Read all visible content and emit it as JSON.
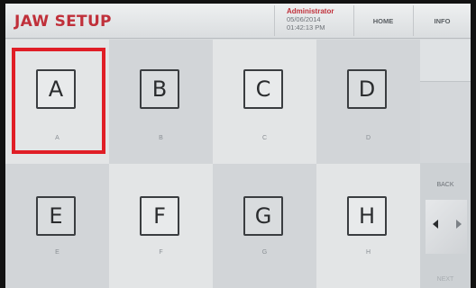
{
  "header": {
    "title": "JAW SETUP",
    "user": "Administrator",
    "date": "05/06/2014",
    "time": "01:42:13 PM",
    "home_label": "HOME",
    "info_label": "INFO"
  },
  "jaws": [
    {
      "letter": "A",
      "caption": "A",
      "selected": true
    },
    {
      "letter": "B",
      "caption": "B"
    },
    {
      "letter": "C",
      "caption": "C"
    },
    {
      "letter": "D",
      "caption": "D"
    },
    {
      "letter": "E",
      "caption": "E"
    },
    {
      "letter": "F",
      "caption": "F"
    },
    {
      "letter": "G",
      "caption": "G"
    },
    {
      "letter": "H",
      "caption": "H"
    }
  ],
  "nav": {
    "back_label": "BACK",
    "next_label": "NEXT",
    "prev_icon": "triangle-left",
    "next_icon": "triangle-right"
  },
  "colors": {
    "accent": "#c0303a",
    "selection": "#e01e26"
  }
}
